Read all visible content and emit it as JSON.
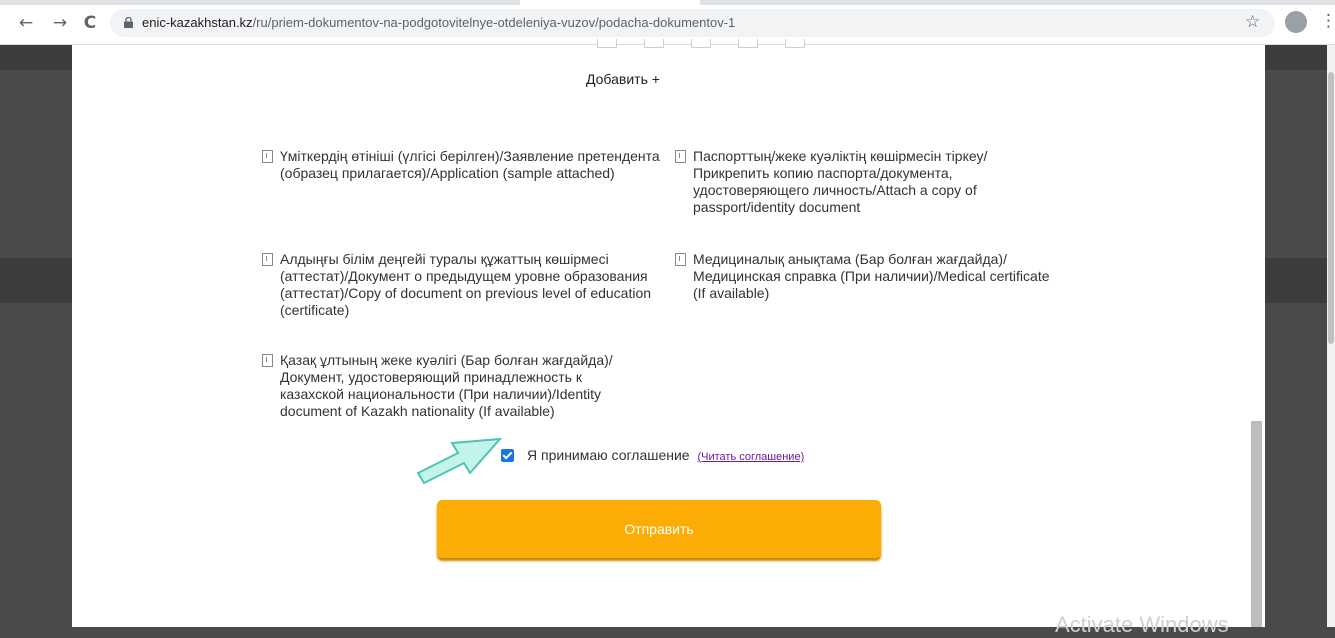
{
  "browser": {
    "url_host": "enic-kazakhstan.kz",
    "url_path": "/ru/priem-dokumentov-na-podgotovitelnye-otdeleniya-vuzov/podacha-dokumentov-1",
    "back_icon": "←",
    "forward_icon": "→",
    "reload_icon": "C",
    "star_icon": "☆",
    "menu_icon": "⋮"
  },
  "form": {
    "add_label": "Добавить +",
    "documents": [
      {
        "label": "Үміткердің өтініші (үлгісі берілген)/Заявление претендента (образец прилагается)/Application (sample attached)"
      },
      {
        "label": "Паспорттың/жеке куәліктің көшірмесін тіркеу/ Прикрепить копию паспорта/документа, удостоверяющего личность/Attach a copy of passport/identity document"
      },
      {
        "label": "Алдыңғы білім деңгейі туралы құжаттың көшірмесі (аттестат)/Документ о предыдущем уровне образования (аттестат)/Copy of document on previous level of education (certificate)"
      },
      {
        "label": "Медициналық анықтама (Бар болған жағдайда)/ Медицинская справка (При наличии)/Medical certificate (If available)"
      },
      {
        "label": "Қазақ ұлтының жеке куәлігі (Бар болған жағдайда)/Документ, удостоверяющий принадлежность к казахской национальности (При наличии)/Identity document of Kazakh nationality (If available)"
      }
    ],
    "agreement_label": "Я принимаю соглашение",
    "agreement_link": "(Читать соглашение)",
    "agreement_checked": true,
    "submit_label": "Отправить"
  },
  "watermark": "Activate Windows",
  "colors": {
    "submit_button": "#fbad05",
    "checkbox": "#1a73e8",
    "page_background": "#4a4a4a"
  }
}
